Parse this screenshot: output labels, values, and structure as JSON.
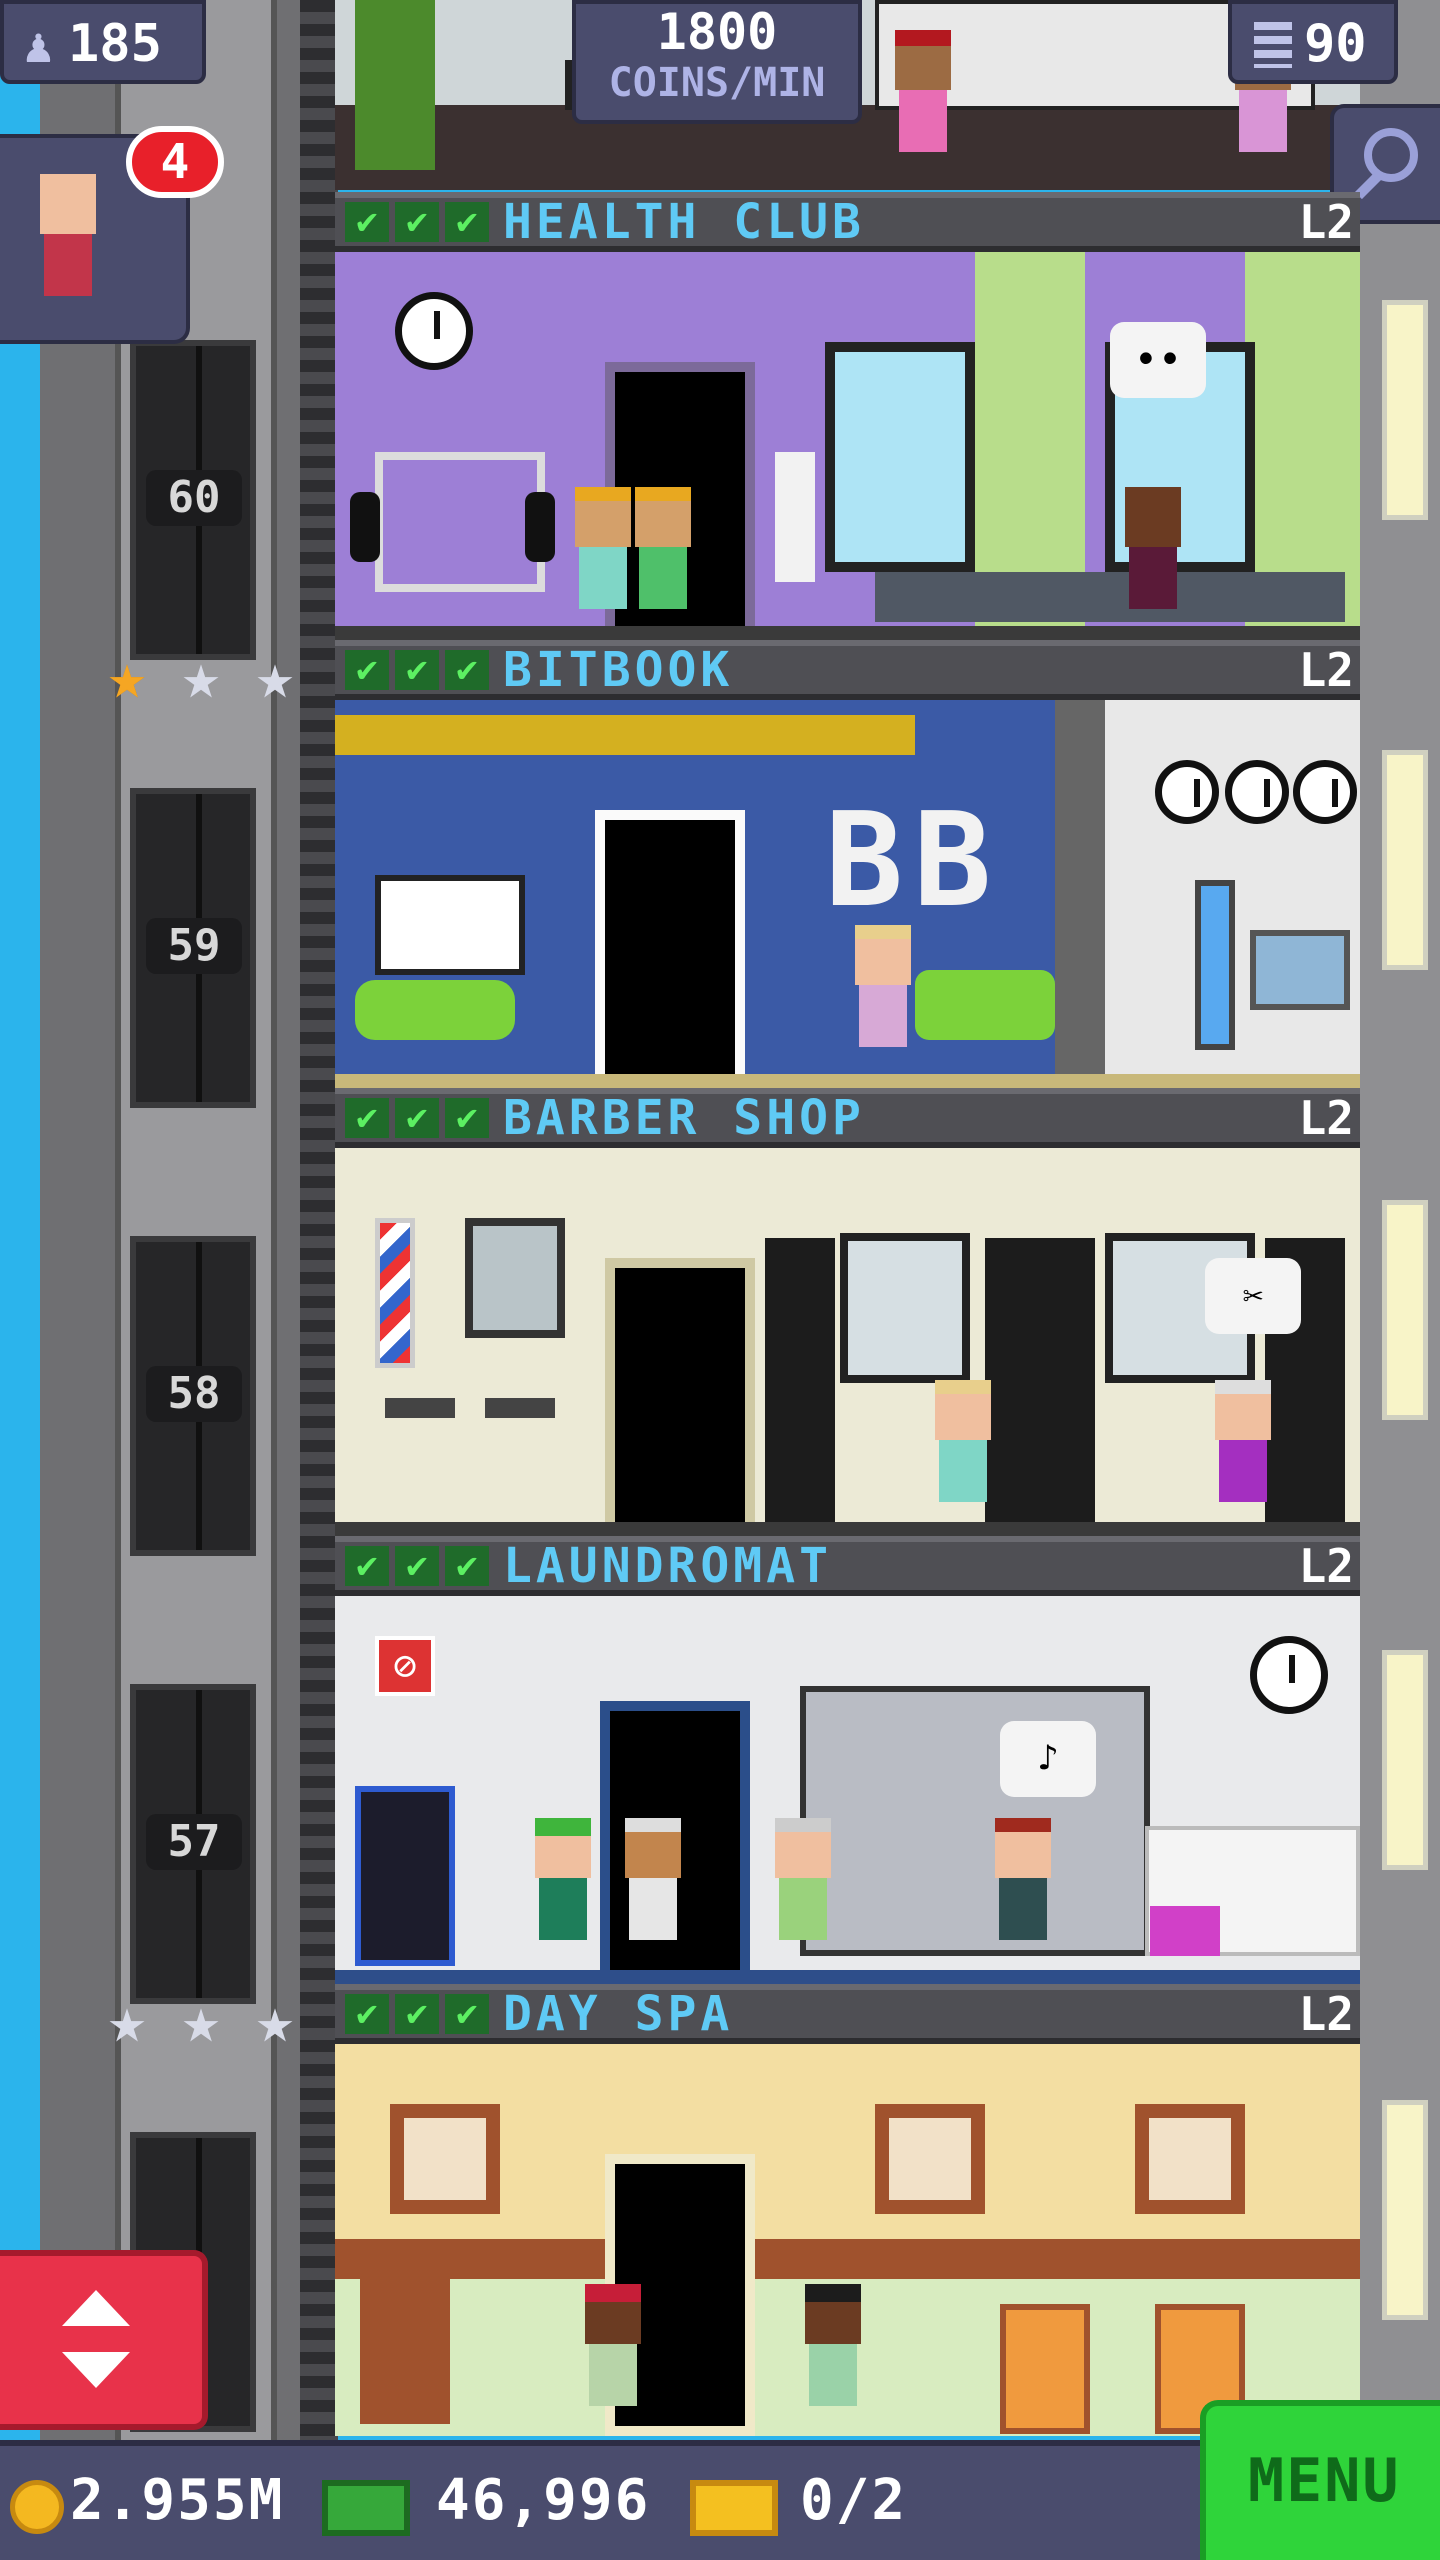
{
  "hud": {
    "residents": "185",
    "rate_value": "1800",
    "rate_unit": "COINS/MIN",
    "floors": "90",
    "notifications": "4"
  },
  "elevator": {
    "floor_numbers": [
      "60",
      "59",
      "58",
      "57"
    ]
  },
  "floors": [
    {
      "name": "HEALTH CLUB",
      "level": "L2"
    },
    {
      "name": "BITBOOK",
      "level": "L2"
    },
    {
      "name": "BARBER SHOP",
      "level": "L2"
    },
    {
      "name": "LAUNDROMAT",
      "level": "L2"
    },
    {
      "name": "DAY SPA",
      "level": "L2"
    }
  ],
  "signs": {
    "bitbook_logo": "BB"
  },
  "bottom": {
    "coins": "2.955M",
    "bux": "46,996",
    "tickets": "0/2",
    "menu_label": "MENU"
  },
  "colors": {
    "sky": "#2bb4ec",
    "hud_bg": "#4a4c6d",
    "floor_name": "#5fcaf5",
    "check_green": "#5cf062",
    "menu_green": "#2fd43a",
    "elevator_button": "#e8324a"
  },
  "icons": {
    "residents": "person-icon",
    "floors": "building-icon",
    "zoom": "magnifier-icon",
    "coins": "coin-icon",
    "bux": "bux-icon",
    "tickets": "ticket-icon",
    "elevator": "up-down-arrow-icon",
    "rating": "star-icon",
    "checks": "checkmark-icon"
  }
}
